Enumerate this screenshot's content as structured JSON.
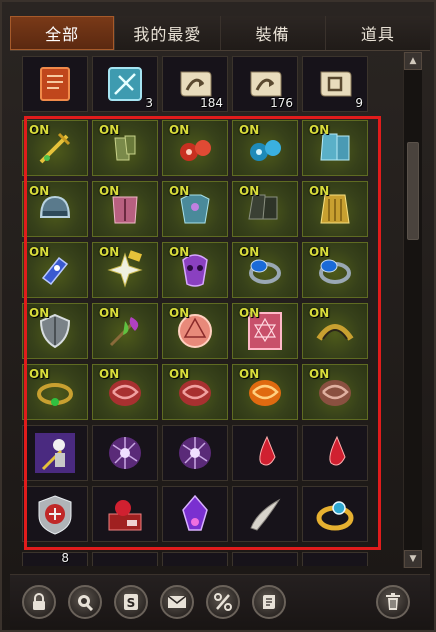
{
  "tabs": [
    {
      "label": "全部",
      "active": true
    },
    {
      "label": "我的最愛",
      "active": false
    },
    {
      "label": "裝備",
      "active": false
    },
    {
      "label": "道具",
      "active": false
    }
  ],
  "top_row": [
    {
      "icon": "red-spellbook-icon",
      "count": ""
    },
    {
      "icon": "blue-scroll-icon",
      "count": "3"
    },
    {
      "icon": "teleport-scroll-icon",
      "count": "184"
    },
    {
      "icon": "teleport-scroll-icon",
      "count": "176"
    },
    {
      "icon": "box-scroll-icon",
      "count": "9"
    }
  ],
  "grid": [
    [
      {
        "icon": "golden-sword-icon",
        "on": "ON"
      },
      {
        "icon": "green-gauntlets-icon",
        "on": "ON"
      },
      {
        "icon": "red-earrings-icon",
        "on": "ON"
      },
      {
        "icon": "blue-earrings-icon",
        "on": "ON"
      },
      {
        "icon": "blue-boots-icon",
        "on": "ON"
      }
    ],
    [
      {
        "icon": "blue-helmet-icon",
        "on": "ON"
      },
      {
        "icon": "pink-armor-icon",
        "on": "ON"
      },
      {
        "icon": "teal-armor-icon",
        "on": "ON"
      },
      {
        "icon": "dark-boots-icon",
        "on": "ON"
      },
      {
        "icon": "gold-cloak-icon",
        "on": "ON"
      }
    ],
    [
      {
        "icon": "blue-bracer-icon",
        "on": "ON"
      },
      {
        "icon": "white-star-amulet-icon",
        "on": "ON"
      },
      {
        "icon": "purple-mask-icon",
        "on": "ON"
      },
      {
        "icon": "blue-gem-ring-icon",
        "on": "ON"
      },
      {
        "icon": "blue-gem-ring-icon",
        "on": "ON"
      }
    ],
    [
      {
        "icon": "silver-shield-icon",
        "on": "ON"
      },
      {
        "icon": "feather-wand-icon",
        "on": "ON"
      },
      {
        "icon": "pink-rune-disk-icon",
        "on": "ON"
      },
      {
        "icon": "pink-rune-tablet-icon",
        "on": "ON"
      },
      {
        "icon": "gold-belt-icon",
        "on": "ON"
      }
    ],
    [
      {
        "icon": "gold-green-ring-icon",
        "on": "ON"
      },
      {
        "icon": "red-stone-icon",
        "on": "ON"
      },
      {
        "icon": "red-stone-icon",
        "on": "ON"
      },
      {
        "icon": "orange-swirl-stone-icon",
        "on": "ON"
      },
      {
        "icon": "brown-stone-icon",
        "on": "ON"
      }
    ],
    [
      {
        "icon": "skeleton-card-icon",
        "on": ""
      },
      {
        "icon": "purple-magic-orb-icon",
        "on": ""
      },
      {
        "icon": "purple-magic-orb-icon",
        "on": ""
      },
      {
        "icon": "red-crystal-icon",
        "on": ""
      },
      {
        "icon": "red-crystal-icon",
        "on": ""
      }
    ],
    [
      {
        "icon": "knight-crest-icon",
        "on": ""
      },
      {
        "icon": "red-potion-box-icon",
        "on": ""
      },
      {
        "icon": "purple-crystal-icon",
        "on": ""
      },
      {
        "icon": "silver-horn-icon",
        "on": ""
      },
      {
        "icon": "gold-blue-ring-icon",
        "on": ""
      }
    ]
  ],
  "partial_row_count": "8",
  "bottom_buttons": [
    {
      "name": "lock-icon",
      "glyph": "🔒"
    },
    {
      "name": "favorite-icon",
      "glyph": "❦"
    },
    {
      "name": "sort-icon",
      "glyph": "S"
    },
    {
      "name": "mail-icon",
      "glyph": "✉"
    },
    {
      "name": "percent-icon",
      "glyph": "%"
    },
    {
      "name": "scroll-icon",
      "glyph": "✎"
    },
    {
      "name": "trash-icon",
      "glyph": "🗑"
    }
  ],
  "colors": {
    "accent": "#e01c1c",
    "on_text": "#d8dc3a",
    "tab_active": "#6a3014"
  }
}
